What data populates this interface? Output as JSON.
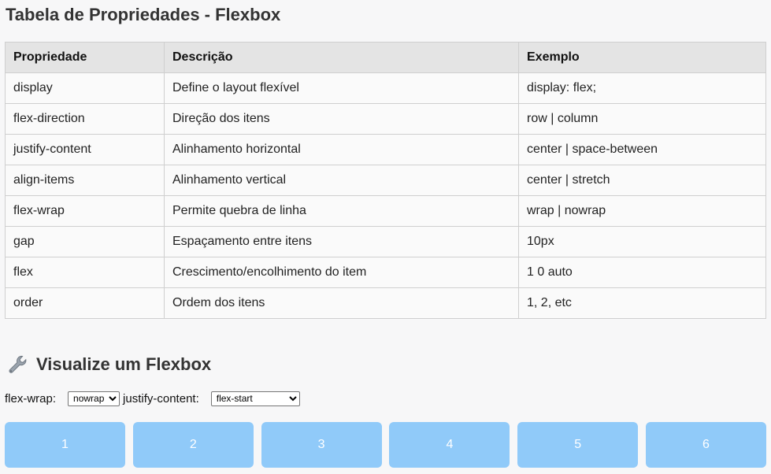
{
  "page": {
    "title": "Tabela de Propriedades - Flexbox"
  },
  "table": {
    "headers": [
      "Propriedade",
      "Descrição",
      "Exemplo"
    ],
    "rows": [
      [
        "display",
        "Define o layout flexível",
        "display: flex;"
      ],
      [
        "flex-direction",
        "Direção dos itens",
        "row | column"
      ],
      [
        "justify-content",
        "Alinhamento horizontal",
        "center | space-between"
      ],
      [
        "align-items",
        "Alinhamento vertical",
        "center | stretch"
      ],
      [
        "flex-wrap",
        "Permite quebra de linha",
        "wrap | nowrap"
      ],
      [
        "gap",
        "Espaçamento entre itens",
        "10px"
      ],
      [
        "flex",
        "Crescimento/encolhimento do item",
        "1 0 auto"
      ],
      [
        "order",
        "Ordem dos itens",
        "1, 2, etc"
      ]
    ]
  },
  "visualizer": {
    "title": "Visualize um Flexbox",
    "icon": "wrench-icon",
    "flex_wrap_label": "flex-wrap:",
    "flex_wrap_value": "nowrap",
    "justify_label": "justify-content:",
    "justify_value": "flex-start",
    "items": [
      "1",
      "2",
      "3",
      "4",
      "5",
      "6"
    ],
    "item_color": "#90caf9"
  }
}
